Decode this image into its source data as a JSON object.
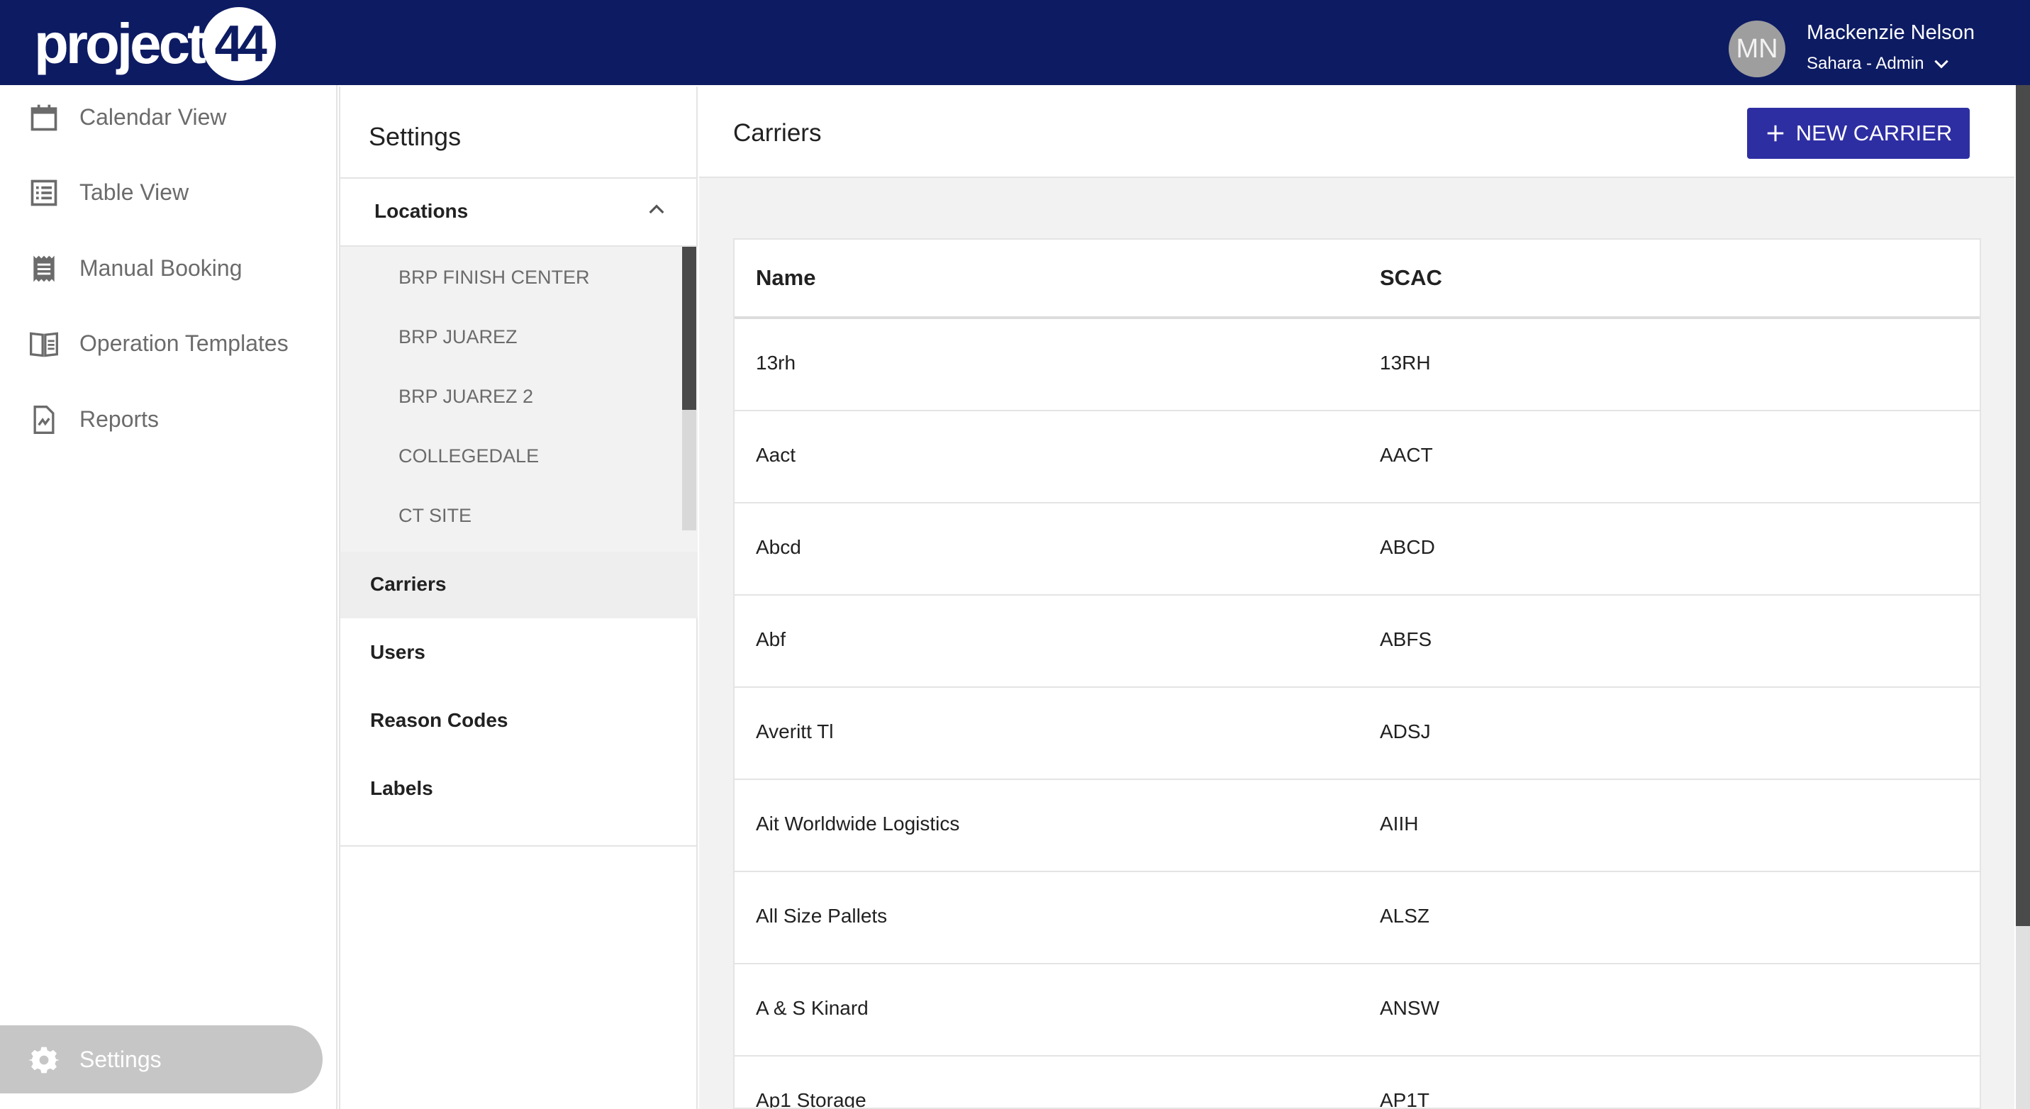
{
  "brand": {
    "logo_text": "project",
    "logo_number": "44",
    "color": "#0d1b63"
  },
  "user": {
    "initials": "MN",
    "name": "Mackenzie Nelson",
    "role": "Sahara - Admin"
  },
  "nav": {
    "items": [
      {
        "label": "Calendar View",
        "icon": "calendar-icon"
      },
      {
        "label": "Table View",
        "icon": "list-icon"
      },
      {
        "label": "Manual Booking",
        "icon": "receipt-icon"
      },
      {
        "label": "Operation Templates",
        "icon": "book-icon"
      },
      {
        "label": "Reports",
        "icon": "report-file-icon"
      }
    ],
    "settings_label": "Settings"
  },
  "settings_panel": {
    "title": "Settings",
    "locations_label": "Locations",
    "locations": [
      "BRP FINISH CENTER",
      "BRP JUAREZ",
      "BRP JUAREZ 2",
      "COLLEGEDALE",
      "CT SITE"
    ],
    "items": [
      "Carriers",
      "Users",
      "Reason Codes",
      "Labels"
    ],
    "active_item": "Carriers"
  },
  "main": {
    "title": "Carriers",
    "new_button_label": "NEW CARRIER",
    "accent_color": "#2e2ea3",
    "columns": [
      "Name",
      "SCAC"
    ],
    "rows": [
      {
        "name": "13rh",
        "scac": "13RH"
      },
      {
        "name": "Aact",
        "scac": "AACT"
      },
      {
        "name": "Abcd",
        "scac": "ABCD"
      },
      {
        "name": "Abf",
        "scac": "ABFS"
      },
      {
        "name": "Averitt Tl",
        "scac": "ADSJ"
      },
      {
        "name": "Ait Worldwide Logistics",
        "scac": "AIIH"
      },
      {
        "name": "All Size Pallets",
        "scac": "ALSZ"
      },
      {
        "name": "A & S Kinard",
        "scac": "ANSW"
      },
      {
        "name": "Ap1 Storage",
        "scac": "AP1T"
      }
    ]
  }
}
